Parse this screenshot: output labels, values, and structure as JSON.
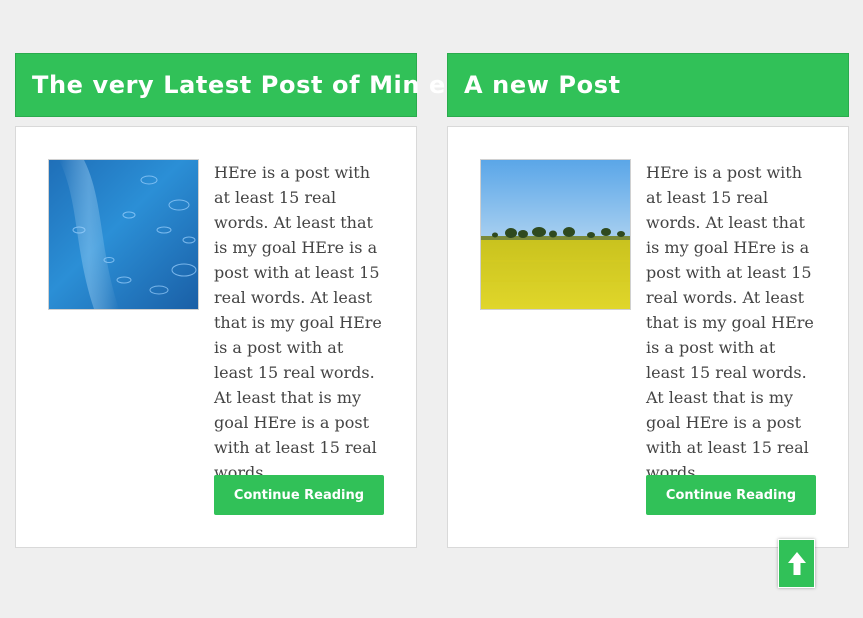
{
  "posts": [
    {
      "title": "The very Latest Post of Min e",
      "excerpt": "HEre is a post with at least 15 real words. At least that is my goal HEre is a post with at least 15 real words. At least that is my goal HEre is a post with at least 15 real words. At least that is my goal HEre is a post with at least 15 real words.",
      "read_more": "Continue Reading",
      "thumbnail": "rain-water-image"
    },
    {
      "title": "A new Post",
      "excerpt": "HEre is a post with at least 15 real words. At least that is my goal HEre is a post with at least 15 real words. At least that is my goal HEre is a post with at least 15 real words. At least that is my goal HEre is a post with at least 15 real words.",
      "read_more": "Continue Reading",
      "thumbnail": "yellow-field-image"
    }
  ],
  "back_to_top": {
    "icon": "arrow-up-icon"
  },
  "colors": {
    "accent": "#31c158",
    "background": "#efefef",
    "card": "#ffffff"
  }
}
